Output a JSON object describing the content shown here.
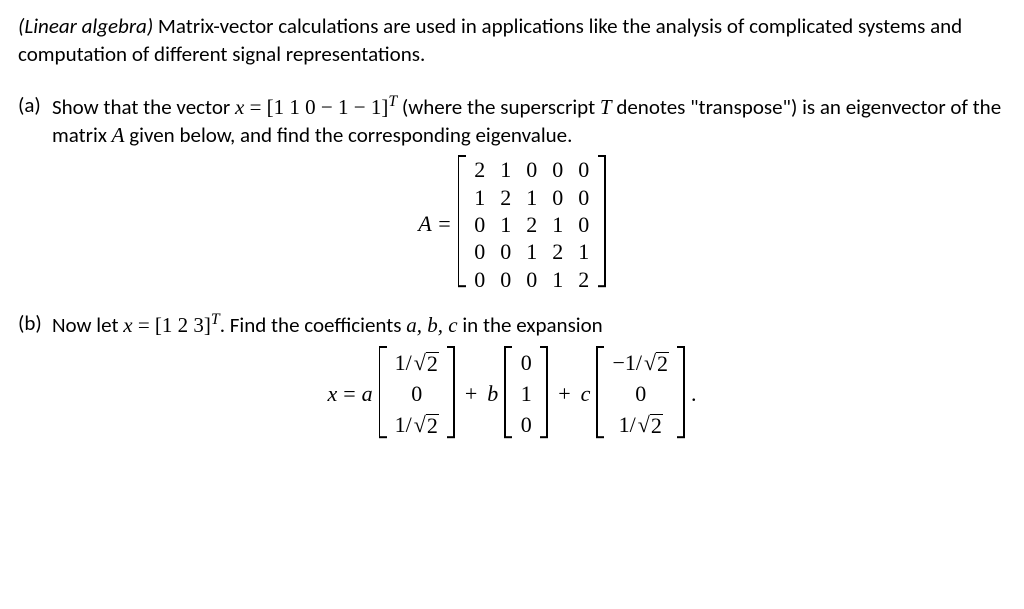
{
  "intro": {
    "subject": "(Linear algebra)",
    "text": " Matrix-vector calculations are used in applications like the analysis of complicated systems and computation of different signal representations."
  },
  "partA": {
    "label": "(a)",
    "pre": "Show that the vector  ",
    "xeq": "x",
    "eq": " = ",
    "vec_open": "[",
    "vec_vals": "1  1  0  − 1  − 1",
    "vec_close": "]",
    "sup": "T",
    "post1": " (where the superscript ",
    "Tword": "T",
    "post2": " denotes \"transpose\") is an eigenvector of the matrix ",
    "Avar": "A",
    "post3": " given below, and find the corresponding eigenvalue.",
    "matrix_lhs": "A =",
    "matrix": [
      [
        "2",
        "1",
        "0",
        "0",
        "0"
      ],
      [
        "1",
        "2",
        "1",
        "0",
        "0"
      ],
      [
        "0",
        "1",
        "2",
        "1",
        "0"
      ],
      [
        "0",
        "0",
        "1",
        "2",
        "1"
      ],
      [
        "0",
        "0",
        "0",
        "1",
        "2"
      ]
    ]
  },
  "partB": {
    "label": "(b)",
    "pre": "Now let ",
    "xeq": "x",
    "eq": " = ",
    "vec_open": "[",
    "vec_vals": "1  2  3",
    "vec_close": "]",
    "sup": "T",
    "post1": ". Find the coefficients ",
    "abc": "a, b, c",
    "post2": " in the expansion",
    "expansion": {
      "lhs_x": "x",
      "lhs_eq": " = ",
      "a": "a",
      "plus1": " + ",
      "b": "b",
      "plus2": " + ",
      "c": "c",
      "period": ".",
      "v1": [
        "1/√2",
        "0",
        "1/√2"
      ],
      "v2": [
        "0",
        "1",
        "0"
      ],
      "v3": [
        "−1/√2",
        "0",
        "1/√2"
      ]
    }
  }
}
